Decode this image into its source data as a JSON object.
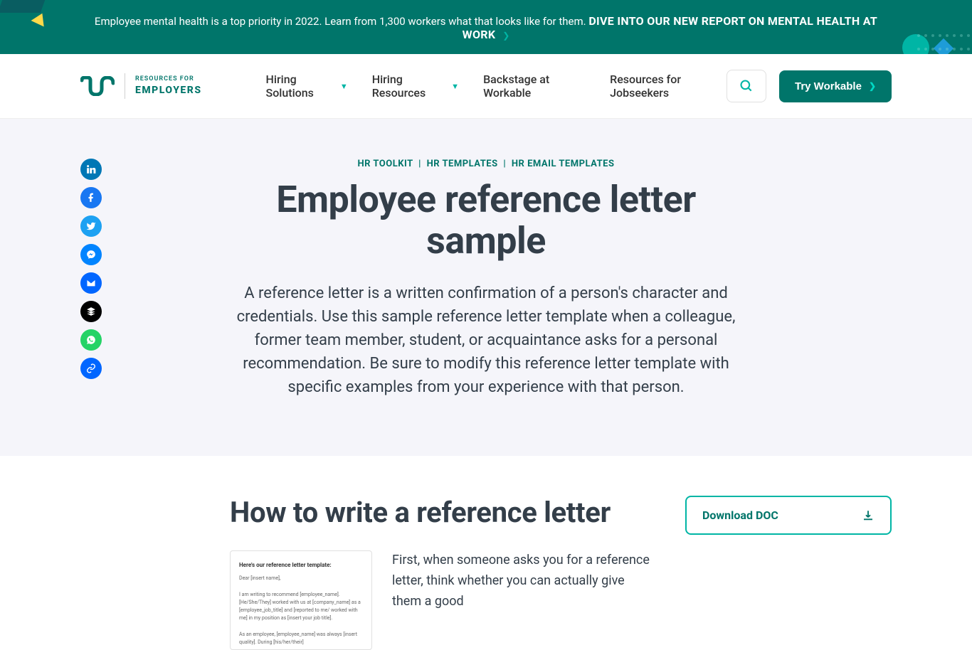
{
  "banner": {
    "text": "Employee mental health is a top priority in 2022. Learn from 1,300 workers what that looks like for them. ",
    "cta": "DIVE INTO OUR NEW REPORT ON MENTAL HEALTH AT WORK"
  },
  "logo": {
    "line1": "RESOURCES FOR",
    "line2": "EMPLOYERS"
  },
  "nav": {
    "item1": "Hiring Solutions",
    "item2": "Hiring Resources",
    "item3": "Backstage at Workable",
    "item4": "Resources for Jobseekers"
  },
  "cta_button": "Try Workable",
  "breadcrumb": {
    "a": "HR TOOLKIT",
    "b": "HR TEMPLATES",
    "c": "HR EMAIL TEMPLATES"
  },
  "hero": {
    "title": "Employee reference letter sample",
    "desc": "A reference letter is a written confirmation of a person's character and credentials. Use this sample reference letter template when a colleague, former team member, student, or acquaintance asks for a personal recommendation. Be sure to modify this reference letter template with specific examples from your experience with that person."
  },
  "section": {
    "title": "How to write a reference letter",
    "p1": "First, when someone asks you for a reference letter, think whether you can actually give them a good"
  },
  "preview": {
    "title": "Here's our reference letter template:",
    "line1": "Dear [insert name],",
    "line2": "I am writing to recommend [employee_name]. [He/She/They] worked with us at [company_name] as a [employee_job_title] and [reported to me/ worked with me] in my position as [insert your job title].",
    "line3": "As an employee, [employee_name] was always [insert quality]. During [his/her/their]"
  },
  "download": "Download DOC"
}
